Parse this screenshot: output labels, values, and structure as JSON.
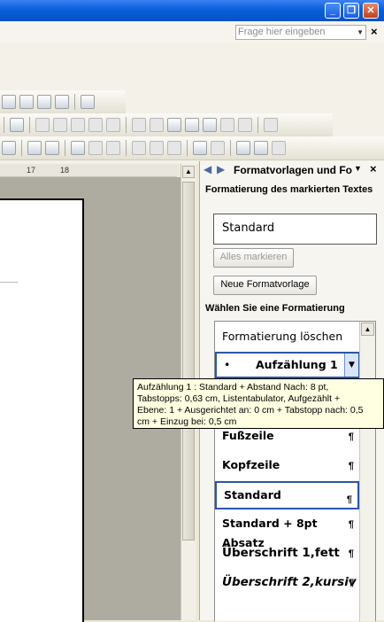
{
  "window": {
    "min": "_",
    "restore": "❐",
    "close": "✕"
  },
  "search": {
    "placeholder": "Frage hier eingeben",
    "close": "×"
  },
  "ruler": {
    "marks": [
      "17",
      "18"
    ]
  },
  "pane": {
    "title": "Formatvorlagen und Fo",
    "section_selected": "Formatierung des markierten Textes",
    "current_style": "Standard",
    "select_all_button": "Alles markieren",
    "new_style_button": "Neue Formatvorlage",
    "section_choose": "Wählen Sie eine Formatierung",
    "styles": [
      {
        "label": "Formatierung löschen",
        "mark": ""
      },
      {
        "label": "Aufzählung 1",
        "mark": ""
      },
      {
        "label": "Fußzeile",
        "mark": "¶"
      },
      {
        "label": "Kopfzeile",
        "mark": "¶"
      },
      {
        "label": "Standard",
        "mark": "¶"
      },
      {
        "label": "Standard + 8pt Absatz",
        "mark": "¶"
      },
      {
        "label": "Überschrift 1,fett",
        "mark": "¶"
      },
      {
        "label": "Überschrift 2,kursiv",
        "mark": "¶"
      }
    ]
  },
  "tooltip": {
    "line1": "Aufzählung 1 : Standard + Abstand Nach:  8 pt,",
    "line2": "Tabstopps:  0,63 cm, Listentabulator, Aufgezählt +",
    "line3": "Ebene: 1 + Ausgerichtet an:  0 cm + Tabstopp nach:  0,5",
    "line4": "cm + Einzug bei:  0,5 cm"
  },
  "colors": {
    "titlebar": "#0a5fd8",
    "selection": "#2b56a6",
    "tooltip_bg": "#ffffe1"
  }
}
